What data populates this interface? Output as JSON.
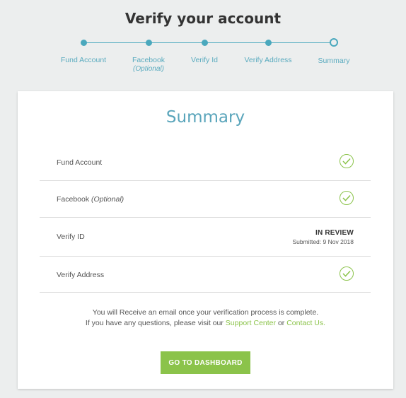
{
  "header": {
    "title": "Verify your account"
  },
  "steps": [
    {
      "label": "Fund Account",
      "sub": ""
    },
    {
      "label": "Facebook",
      "sub": "(Optional)"
    },
    {
      "label": "Verify Id",
      "sub": ""
    },
    {
      "label": "Verify Address",
      "sub": ""
    },
    {
      "label": "Summary",
      "sub": ""
    }
  ],
  "summary": {
    "title": "Summary",
    "rows": [
      {
        "label": "Fund Account",
        "optional": "",
        "status": "complete"
      },
      {
        "label": "Facebook",
        "optional": "(Optional)",
        "status": "complete"
      },
      {
        "label": "Verify ID",
        "optional": "",
        "status": "in-review",
        "status_text": "IN REVIEW",
        "submitted": "Submitted: 9 Nov 2018"
      },
      {
        "label": "Verify Address",
        "optional": "",
        "status": "complete"
      }
    ],
    "info_line1": "You will Receive an email once your verification process is complete.",
    "info_line2_pre": "If you have any questions, please visit our",
    "support_link": "Support Center",
    "or_text": "or",
    "contact_link": "Contact Us.",
    "button_label": "GO TO DASHBOARD"
  },
  "colors": {
    "accent": "#4aa8bd",
    "success": "#8bc34a"
  },
  "icons": {
    "complete": "check-circle-icon"
  }
}
